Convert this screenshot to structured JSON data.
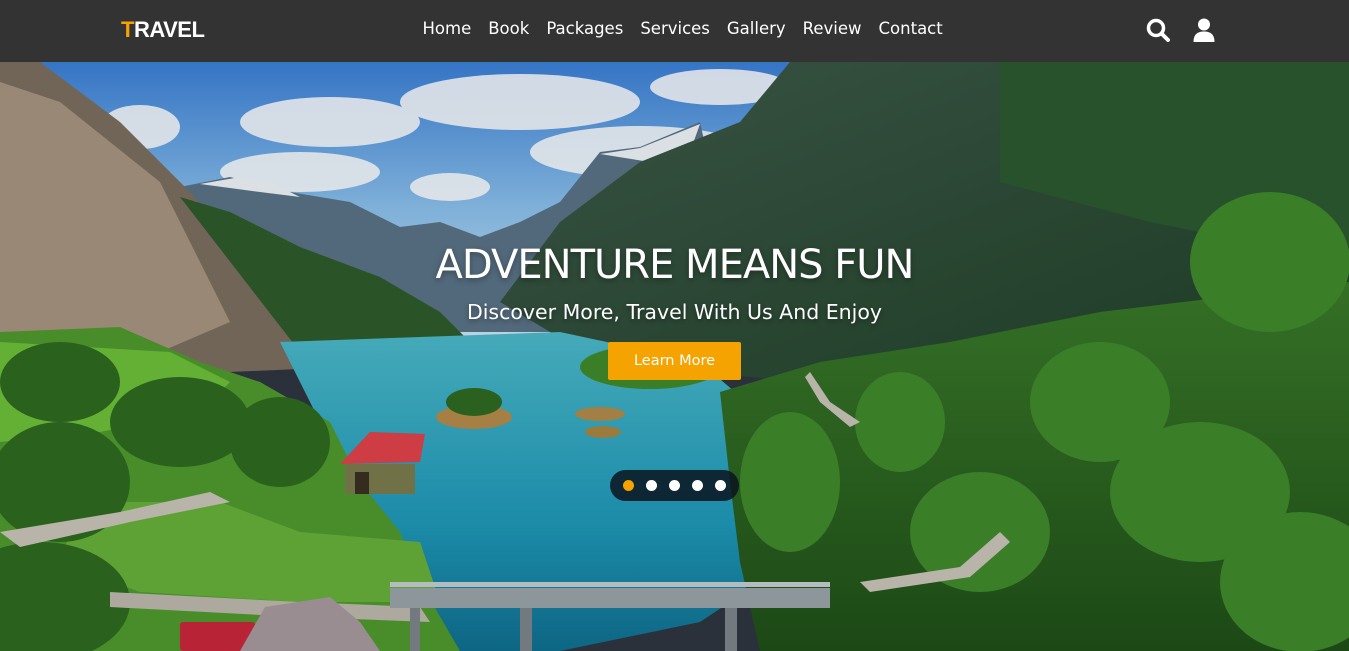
{
  "brand": {
    "first_letter": "T",
    "rest": "RAVEL"
  },
  "nav": {
    "links": [
      "Home",
      "Book",
      "Packages",
      "Services",
      "Gallery",
      "Review",
      "Contact"
    ],
    "icons": [
      "search-icon",
      "user-icon"
    ]
  },
  "hero": {
    "title": "ADVENTURE MEANS FUN",
    "subtitle": "Discover More, Travel With Us And Enjoy",
    "button_label": "Learn More",
    "slides": {
      "count": 5,
      "active": 0
    }
  },
  "colors": {
    "accent": "#f5a300",
    "navbar": "#333333",
    "text": "#ffffff"
  }
}
